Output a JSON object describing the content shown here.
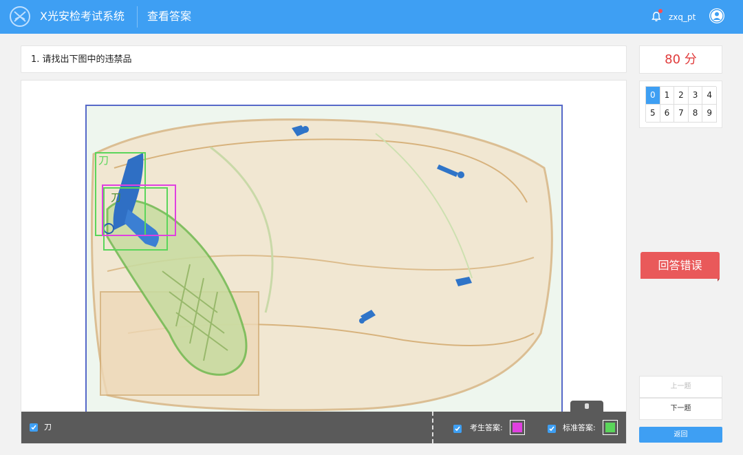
{
  "header": {
    "app_title": "X光安检考试系统",
    "page_title": "查看答案",
    "username": "zxq_pt"
  },
  "question": {
    "text": "1. 请找出下图中的违禁品"
  },
  "image": {
    "box_labels": [
      "刀",
      "刀"
    ]
  },
  "toolbar": {
    "item_label": "刀",
    "student_answer_label": "考生答案:",
    "standard_answer_label": "标准答案:"
  },
  "score": {
    "text": "80 分"
  },
  "question_grid": {
    "numbers": [
      "0",
      "1",
      "2",
      "3",
      "4",
      "5",
      "6",
      "7",
      "8",
      "9"
    ],
    "active_index": 0
  },
  "result": {
    "banner": "回答错误"
  },
  "nav": {
    "prev": "上一题",
    "next": "下一题",
    "back": "返回"
  },
  "colors": {
    "header": "#3e9ff3",
    "student_box": "#e040e0",
    "standard_box": "#5ad55a",
    "wrong": "#e9595a"
  }
}
